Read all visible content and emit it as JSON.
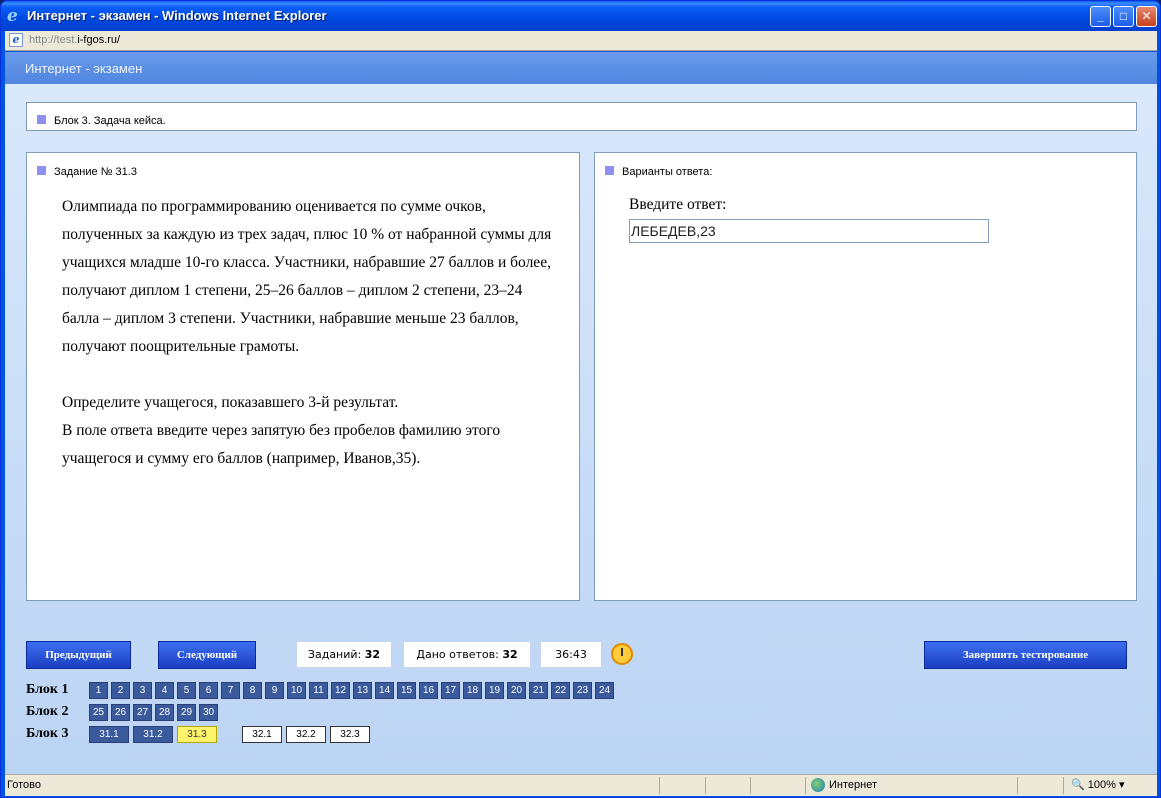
{
  "window": {
    "title": "Интернет - экзамен - Windows Internet Explorer",
    "address": "http://test.",
    "address_bold": "i-fgos.ru/",
    "minimize": "_",
    "maximize": "□",
    "close": "✕"
  },
  "app": {
    "header": "Интернет - экзамен",
    "block_title": "Блок 3. Задача кейса.",
    "task_label": "Задание № 31.3",
    "answer_panel_label": "Варианты ответа:",
    "task_paragraph1": "Олимпиада по программированию оценивается по сумме очков, полученных за каждую из трех задач, плюс 10 % от набранной суммы для учащихся младше 10-го класса. Участники, набравшие 27 баллов и более, получают диплом 1 степени, 25–26 баллов – диплом 2 степени, 23–24 балла – диплом 3 степени. Участники, набравшие меньше 23 баллов, получают поощрительные грамоты.",
    "task_paragraph2": "Определите учащегося, показавшего 3-й результат.",
    "task_paragraph3": "В поле ответа введите через запятую без пробелов фамилию этого учащегося и сумму его баллов (например, Иванов,35).",
    "answer_prompt": "Введите ответ:",
    "answer_value": "ЛЕБЕДЕВ,23"
  },
  "controls": {
    "prev": "Предыдущий",
    "next": "Следующий",
    "tasks_label": "Заданий:",
    "tasks_count": "32",
    "answers_label": "Дано ответов:",
    "answers_count": "32",
    "timer": "36:43",
    "finish": "Завершить тестирование"
  },
  "blocks": {
    "block1_label": "Блок 1",
    "block1": [
      "1",
      "2",
      "3",
      "4",
      "5",
      "6",
      "7",
      "8",
      "9",
      "10",
      "11",
      "12",
      "13",
      "14",
      "15",
      "16",
      "17",
      "18",
      "19",
      "20",
      "21",
      "22",
      "23",
      "24"
    ],
    "block2_label": "Блок 2",
    "block2": [
      "25",
      "26",
      "27",
      "28",
      "29",
      "30"
    ],
    "block3_label": "Блок 3",
    "block3_done": [
      "31.1",
      "31.2"
    ],
    "block3_current": "31.3",
    "block3_todo": [
      "32.1",
      "32.2",
      "32.3"
    ]
  },
  "status": {
    "text": "Готово",
    "zone": "Интернет",
    "zoom": "100%"
  },
  "colors": {
    "done_cell": "#3a5a9c",
    "current_cell": "#fff36c",
    "button_blue": "#1a3fc2"
  }
}
